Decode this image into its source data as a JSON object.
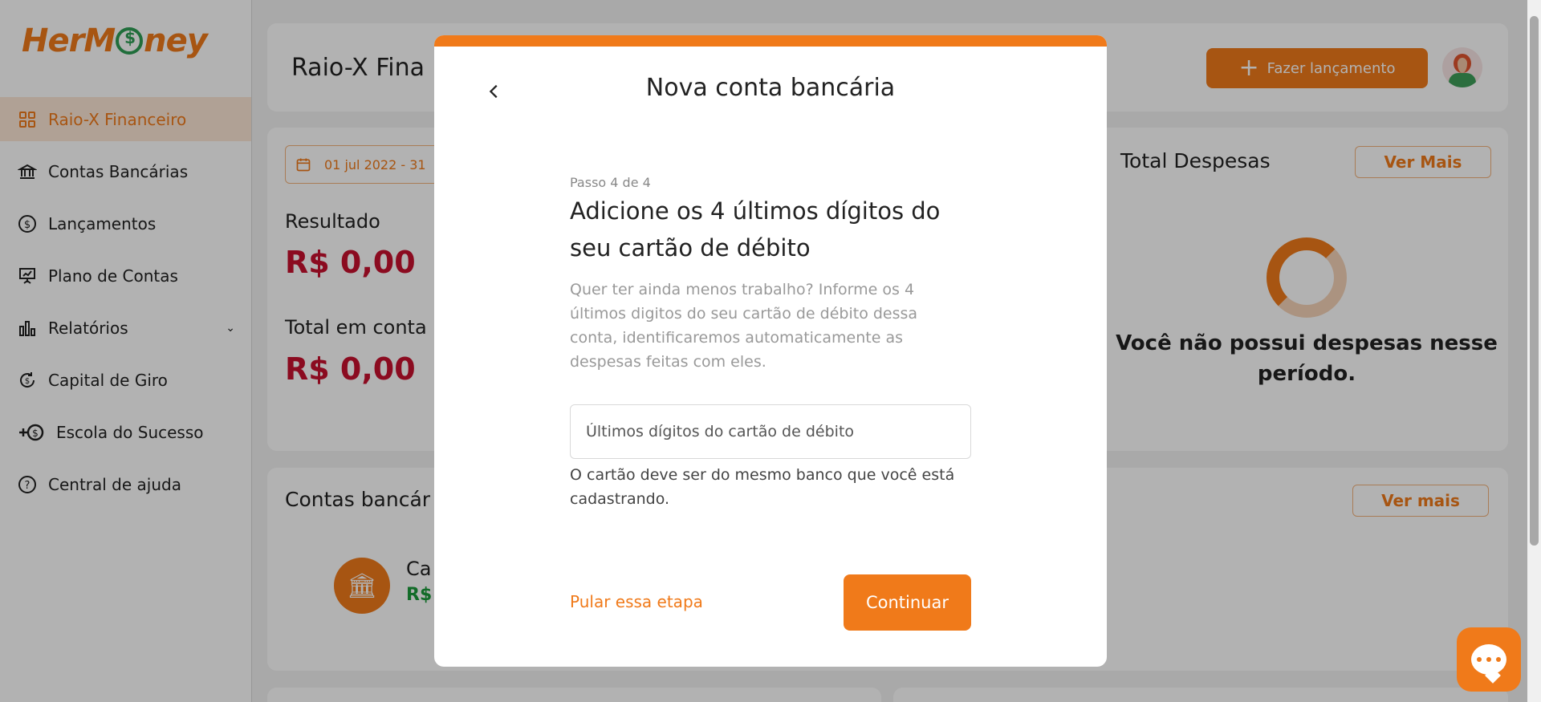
{
  "app": {
    "logo_text_a": "Her",
    "logo_text_b": "ney",
    "brand_color": "#f07a1a"
  },
  "sidebar": {
    "items": [
      {
        "label": "Raio-X Financeiro",
        "icon": "grid-icon",
        "active": true
      },
      {
        "label": "Contas Bancárias",
        "icon": "bank-icon"
      },
      {
        "label": "Lançamentos",
        "icon": "dollar-circle-icon"
      },
      {
        "label": "Plano de Contas",
        "icon": "presentation-icon"
      },
      {
        "label": "Relatórios",
        "icon": "bar-chart-icon"
      },
      {
        "label": "Capital de Giro",
        "icon": "refresh-dollar-icon"
      },
      {
        "label": "Escola do Sucesso",
        "icon": "plus-dollar-icon"
      },
      {
        "label": "Central de ajuda",
        "icon": "question-circle-icon"
      }
    ]
  },
  "header": {
    "title": "Raio-X Fina",
    "launch_button": "Fazer lançamento"
  },
  "summary": {
    "date_range": "01 jul 2022 - 31",
    "result_label": "Resultado",
    "result_value": "R$ 0,00",
    "total_label": "Total em conta",
    "total_value": "R$ 0,00"
  },
  "expenses": {
    "title": "Total Despesas",
    "more_button": "Ver Mais",
    "empty_message": "Você não possui despesas nesse período."
  },
  "accounts": {
    "title": "Contas bancár",
    "more_button": "Ver mais",
    "bank_name": "Ca",
    "bank_balance": "R$"
  },
  "modal": {
    "title": "Nova conta bancária",
    "step": "Passo 4 de 4",
    "question": "Adicione os 4 últimos dígitos do seu cartão de débito",
    "help": "Quer ter ainda menos trabalho? Informe os 4 últimos digitos do seu cartão de débito dessa conta, identificaremos automaticamente as despesas feitas com eles.",
    "input_placeholder": "Últimos dígitos do cartão de débito",
    "hint": "O cartão deve ser do mesmo banco que você está cadastrando.",
    "skip_label": "Pular essa etapa",
    "continue_label": "Continuar"
  }
}
